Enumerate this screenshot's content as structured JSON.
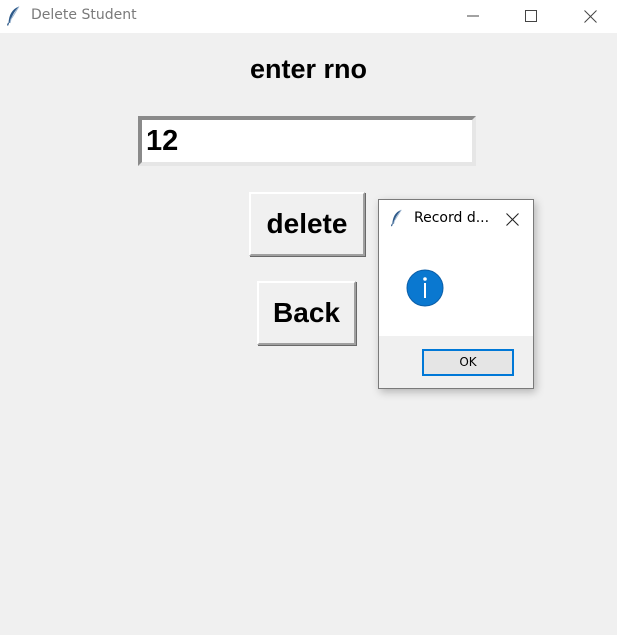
{
  "window": {
    "title": "Delete Student",
    "icon": "feather-icon"
  },
  "form": {
    "heading": "enter rno",
    "rno_value": "12",
    "delete_label": "delete",
    "back_label": "Back"
  },
  "dialog": {
    "title": "Record d...",
    "icon": "info-icon",
    "ok_label": "OK"
  },
  "colors": {
    "window_background": "#f0f0f0",
    "title_text": "#7a7a7a",
    "ok_button_border": "#0078d7",
    "info_icon": "#0a78d0"
  }
}
